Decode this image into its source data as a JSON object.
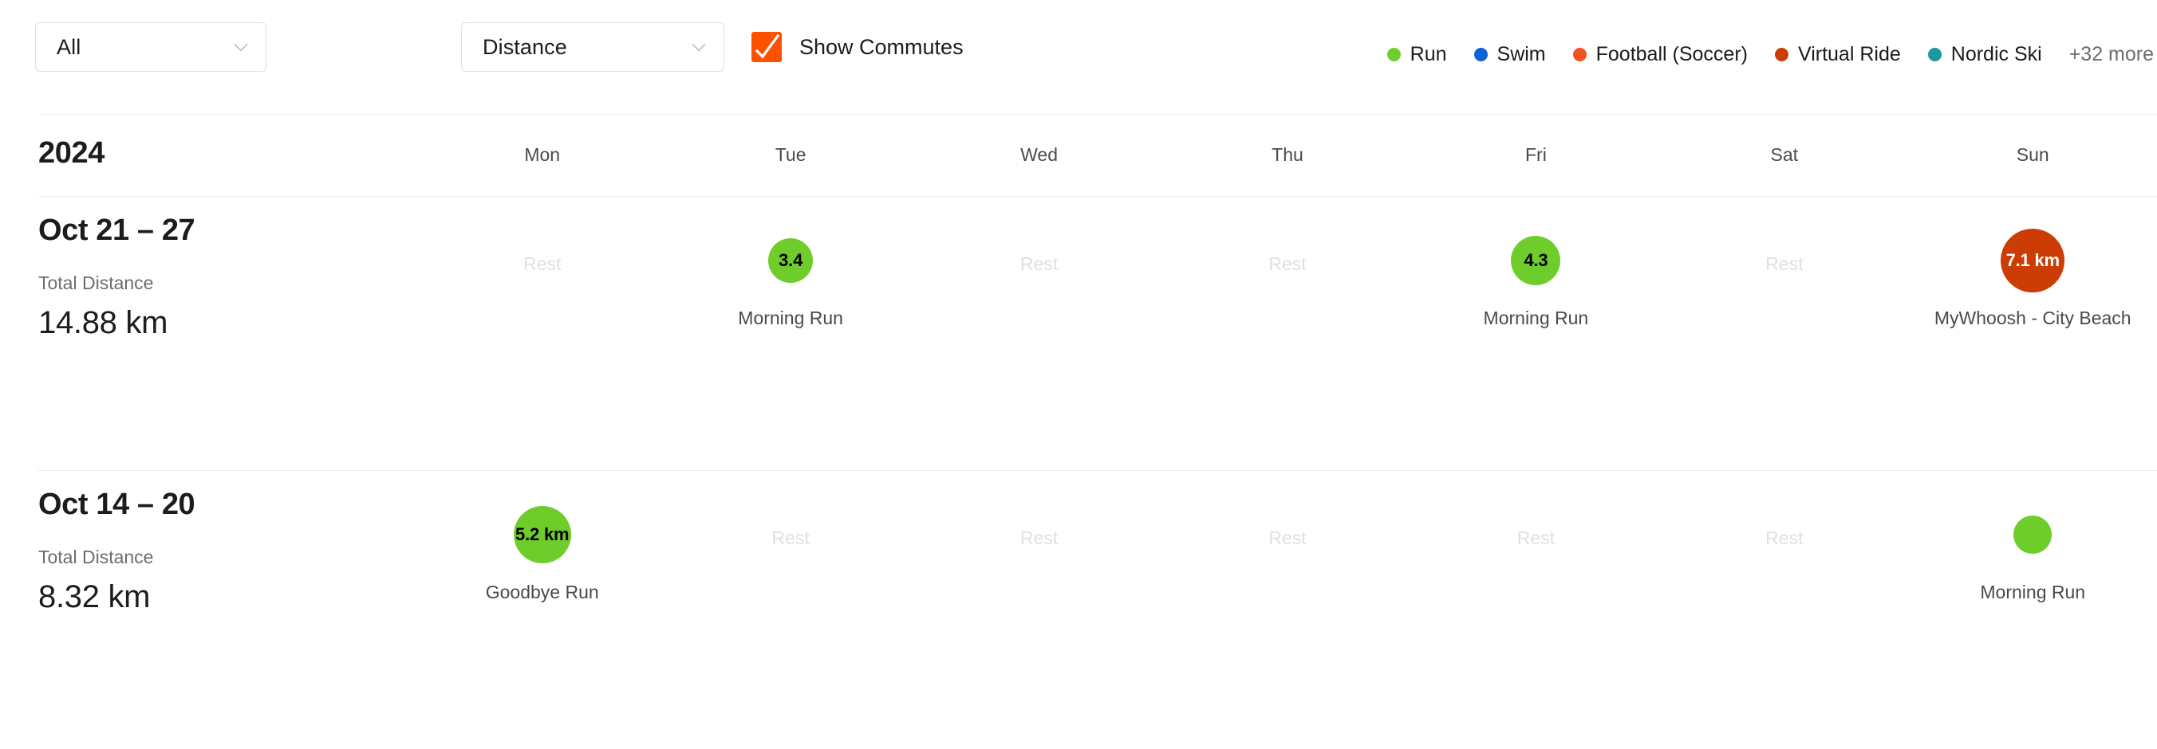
{
  "toolbar": {
    "activity_type_filter": {
      "value": "All",
      "icon": "chevron-down-icon"
    },
    "metric_filter": {
      "value": "Distance",
      "icon": "chevron-down-icon"
    },
    "show_commutes": {
      "label": "Show Commutes",
      "checked": true,
      "color": "#fc5200"
    },
    "legend": {
      "items": [
        {
          "label": "Run",
          "color": "#6fcd2b"
        },
        {
          "label": "Swim",
          "color": "#0b63d6"
        },
        {
          "label": "Football (Soccer)",
          "color": "#f4511e"
        },
        {
          "label": "Virtual Ride",
          "color": "#cc3d05"
        },
        {
          "label": "Nordic Ski",
          "color": "#1a9a9a"
        }
      ],
      "more_label": "+32 more"
    }
  },
  "calendar": {
    "year": "2024",
    "day_headers": [
      "Mon",
      "Tue",
      "Wed",
      "Thu",
      "Fri",
      "Sat",
      "Sun"
    ],
    "rest_label": "Rest",
    "stat_label": "Total Distance",
    "weeks": [
      {
        "title": "Oct 21 – 27",
        "stat_label": "Total Distance",
        "stat_value": "14.88 km",
        "days": [
          {
            "day": "Mon",
            "rest": true
          },
          {
            "day": "Tue",
            "rest": false,
            "bubble_text": "3.4",
            "name": "Morning Run",
            "color": "#6fcd2b",
            "text_color": "#000000",
            "size": 56
          },
          {
            "day": "Wed",
            "rest": true
          },
          {
            "day": "Thu",
            "rest": true
          },
          {
            "day": "Fri",
            "rest": false,
            "bubble_text": "4.3",
            "name": "Morning Run",
            "color": "#6fcd2b",
            "text_color": "#000000",
            "size": 62
          },
          {
            "day": "Sat",
            "rest": true
          },
          {
            "day": "Sun",
            "rest": false,
            "bubble_text": "7.1 km",
            "name": "MyWhoosh - City Beach",
            "color": "#cc3d05",
            "text_color": "#ffffff",
            "size": 80
          }
        ]
      },
      {
        "title": "Oct 14 – 20",
        "stat_label": "Total Distance",
        "stat_value": "8.32 km",
        "days": [
          {
            "day": "Mon",
            "rest": false,
            "bubble_text": "5.2 km",
            "name": "Goodbye Run",
            "color": "#6fcd2b",
            "text_color": "#000000",
            "size": 72
          },
          {
            "day": "Tue",
            "rest": true
          },
          {
            "day": "Wed",
            "rest": true
          },
          {
            "day": "Thu",
            "rest": true
          },
          {
            "day": "Fri",
            "rest": true
          },
          {
            "day": "Sat",
            "rest": true
          },
          {
            "day": "Sun",
            "rest": false,
            "bubble_text": "",
            "name": "Morning Run",
            "color": "#6fcd2b",
            "text_color": "#000000",
            "size": 48
          }
        ]
      }
    ]
  }
}
